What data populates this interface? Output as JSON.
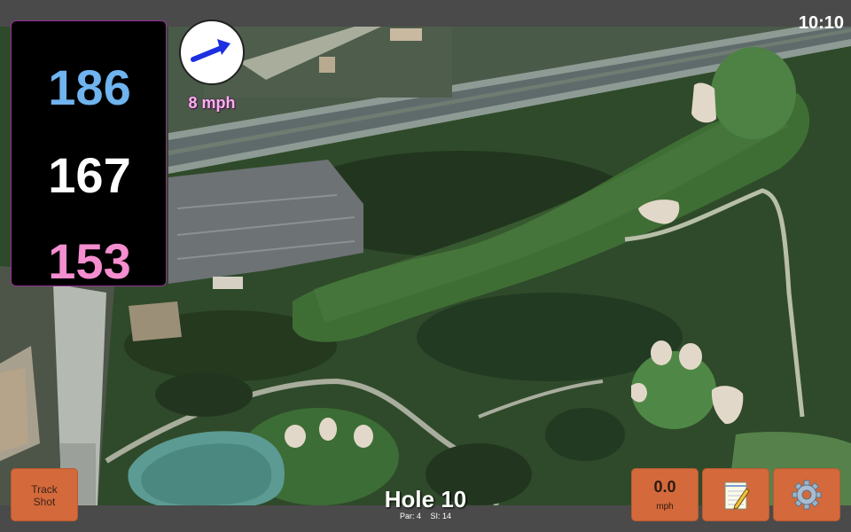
{
  "status_bar": {
    "clock": "10:10"
  },
  "distances": {
    "back": "186",
    "center": "167",
    "front": "153"
  },
  "wind": {
    "speed_label": "8 mph",
    "direction_icon": "arrow-icon"
  },
  "hole": {
    "title": "Hole 10",
    "par_label": "Par: 4",
    "si_label": "SI: 14"
  },
  "buttons": {
    "track_shot_line1": "Track",
    "track_shot_line2": "Shot",
    "speed_value": "0.0",
    "speed_unit": "mph",
    "notes_icon": "notepad-icon",
    "settings_icon": "gear-icon"
  },
  "colors": {
    "back_distance": "#6fb3ef",
    "center_distance": "#ffffff",
    "front_distance": "#f58ed0",
    "button": "#d4693b",
    "panel_border": "#9a2f9a"
  }
}
